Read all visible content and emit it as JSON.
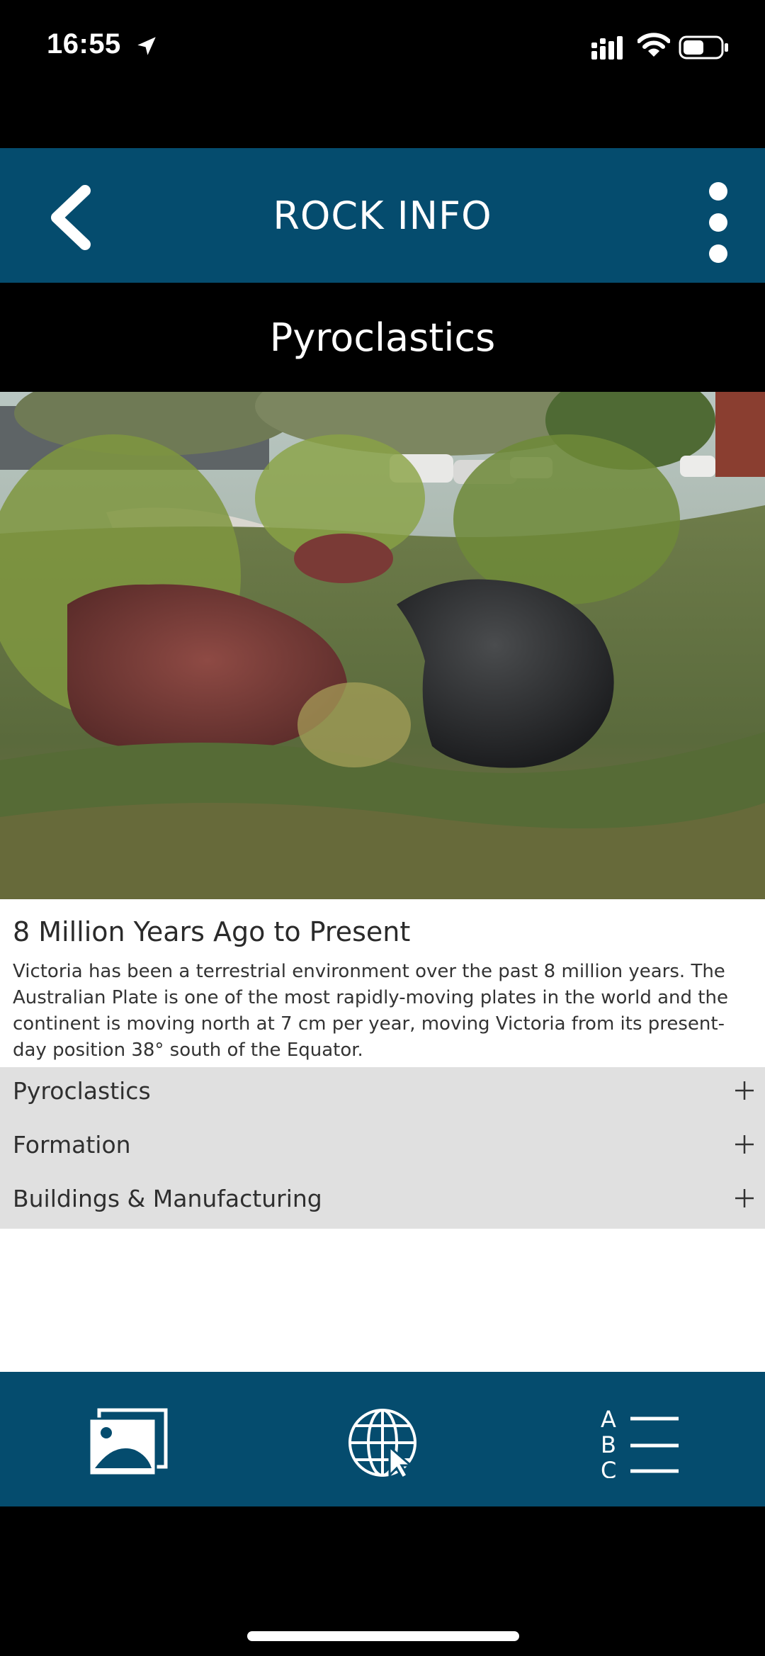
{
  "status": {
    "time": "16:55"
  },
  "header": {
    "title": "ROCK INFO"
  },
  "rock": {
    "name": "Pyroclastics"
  },
  "content": {
    "heading": "8 Million Years Ago to Present",
    "body": "Victoria has been a terrestrial environment over the past 8 million years. The Australian Plate is one of the most rapidly-moving plates in the world and the continent is moving north at 7 cm per year, moving Victoria from its present-day position 38° south of the Equator."
  },
  "accordion": [
    {
      "label": "Pyroclastics"
    },
    {
      "label": "Formation"
    },
    {
      "label": "Buildings & Manufacturing"
    }
  ],
  "nav": {
    "glossary_letters": [
      "A",
      "B",
      "C"
    ]
  },
  "colors": {
    "brand": "#054c6e",
    "accordion_bg": "#e0e0e0"
  }
}
